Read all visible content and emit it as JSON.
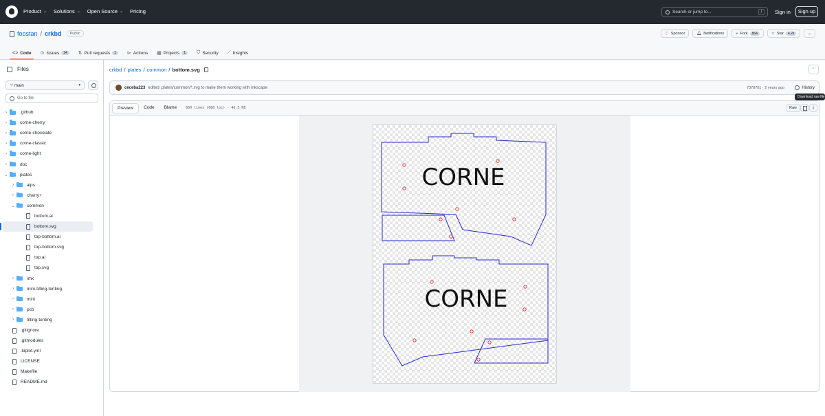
{
  "header": {
    "nav": [
      {
        "label": "Product",
        "has_menu": true
      },
      {
        "label": "Solutions",
        "has_menu": true
      },
      {
        "label": "Open Source",
        "has_menu": true
      },
      {
        "label": "Pricing",
        "has_menu": false
      }
    ],
    "search_placeholder": "Search or jump to...",
    "search_shortcut": "/",
    "sign_in": "Sign in",
    "sign_up": "Sign up"
  },
  "repo": {
    "owner": "foostan",
    "separator": "/",
    "name": "crkbd",
    "visibility": "Public",
    "actions": {
      "sponsor": "Sponsor",
      "notifications": "Notifications",
      "fork_label": "Fork",
      "fork_count": "864",
      "star_label": "Star",
      "star_count": "4.2k"
    },
    "tabs": [
      {
        "label": "Code",
        "icon": "code-icon",
        "count": ""
      },
      {
        "label": "Issues",
        "icon": "issue-icon",
        "count": "14"
      },
      {
        "label": "Pull requests",
        "icon": "pull-request-icon",
        "count": "1"
      },
      {
        "label": "Actions",
        "icon": "play-icon",
        "count": ""
      },
      {
        "label": "Projects",
        "icon": "table-icon",
        "count": "1"
      },
      {
        "label": "Security",
        "icon": "shield-icon",
        "count": ""
      },
      {
        "label": "Insights",
        "icon": "graph-icon",
        "count": ""
      }
    ]
  },
  "sidebar": {
    "title": "Files",
    "branch": "main",
    "goto_placeholder": "Go to file",
    "tree": [
      {
        "name": ".github",
        "type": "dir",
        "depth": 0,
        "open": false
      },
      {
        "name": "corne-cherry",
        "type": "dir",
        "depth": 0,
        "open": false
      },
      {
        "name": "corne-chocolate",
        "type": "dir",
        "depth": 0,
        "open": false
      },
      {
        "name": "corne-classic",
        "type": "dir",
        "depth": 0,
        "open": false
      },
      {
        "name": "corne-light",
        "type": "dir",
        "depth": 0,
        "open": false
      },
      {
        "name": "doc",
        "type": "dir",
        "depth": 0,
        "open": false
      },
      {
        "name": "plates",
        "type": "dir",
        "depth": 0,
        "open": true
      },
      {
        "name": "alps",
        "type": "dir",
        "depth": 1,
        "open": false
      },
      {
        "name": "cherry+",
        "type": "dir",
        "depth": 1,
        "open": false
      },
      {
        "name": "common",
        "type": "dir",
        "depth": 1,
        "open": true
      },
      {
        "name": "bottom.ai",
        "type": "file",
        "depth": 2
      },
      {
        "name": "bottom.svg",
        "type": "file",
        "depth": 2,
        "selected": true
      },
      {
        "name": "top-bottom.ai",
        "type": "file",
        "depth": 2
      },
      {
        "name": "top-bottom.svg",
        "type": "file",
        "depth": 2
      },
      {
        "name": "top.ai",
        "type": "file",
        "depth": 2
      },
      {
        "name": "top.svg",
        "type": "file",
        "depth": 2
      },
      {
        "name": "imk",
        "type": "dir",
        "depth": 1,
        "open": false
      },
      {
        "name": "mini-tilting-tenting",
        "type": "dir",
        "depth": 1,
        "open": false
      },
      {
        "name": "mini",
        "type": "dir",
        "depth": 1,
        "open": false
      },
      {
        "name": "pcb",
        "type": "dir",
        "depth": 1,
        "open": false
      },
      {
        "name": "tilting-tenting",
        "type": "dir",
        "depth": 1,
        "open": false
      },
      {
        "name": ".gitignore",
        "type": "file",
        "depth": 0
      },
      {
        "name": ".gitmodules",
        "type": "file",
        "depth": 0
      },
      {
        "name": ".kiplot.yml",
        "type": "file",
        "depth": 0
      },
      {
        "name": "LICENSE",
        "type": "file",
        "depth": 0
      },
      {
        "name": "Makefile",
        "type": "file",
        "depth": 0
      },
      {
        "name": "README.md",
        "type": "file",
        "depth": 0
      }
    ]
  },
  "breadcrumb": {
    "parts": [
      "crkbd",
      "plates",
      "common"
    ],
    "separator": "/",
    "current": "bottom.svg"
  },
  "commit": {
    "author": "ceceba223",
    "message": "edited .plates/common/*.svg to make them working with inkscape",
    "meta": "7378701 · 2 years ago",
    "history": "History"
  },
  "file_view": {
    "modes": [
      "Preview",
      "Code",
      "Blame"
    ],
    "active_mode": "Preview",
    "info": "660 lines (660 loc) · 46.5 KB",
    "raw": "Raw",
    "tooltip": "Download raw file",
    "preview_text_top": "CORNE",
    "preview_text_bottom": "CORNE"
  },
  "colors": {
    "header_bg": "#24292f",
    "link": "#0969da",
    "active_tab_underline": "#fd8c73",
    "folder": "#54aeff",
    "plate_outline": "#2a2acf",
    "hole": "#e03030"
  }
}
